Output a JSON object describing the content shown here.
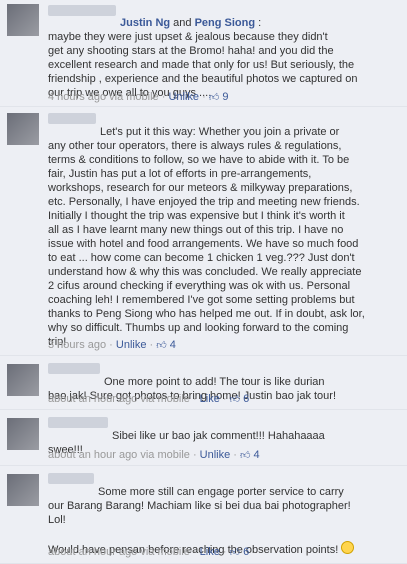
{
  "comments": [
    {
      "mention_prefix": "",
      "mention_1": "Justin Ng",
      "mention_and": " and ",
      "mention_2": "Peng Siong",
      "mention_suffix": " :",
      "text": "maybe they were just upset & jealous because they didn't\nget any shooting stars at the Bromo! haha! and you did the\nexcellent research and made that only for us! But seriously, the\nfriendship , experience and the beautiful photos we captured on\nour trip we owe all to you guys ....",
      "time": "4 hours ago via mobile",
      "action": "Unlike",
      "likes": "9"
    },
    {
      "text": "Let's put it this way: Whether you join a private or\nany other tour operators, there is always rules & regulations,\nterms & conditions to follow, so we have to abide with it. To be\nfair, Justin has put a lot of efforts in pre-arrangements,\nworkshops, research for our meteors & milkyway preparations,\netc. Personally, I have enjoyed the trip and meeting new friends.\nInitially I thought the trip was expensive but I think it's worth it\nall as I have learnt many new things out of this trip. I have no\nissue with hotel and food arrangements. We have so much food\nto eat ... how come can become 1 chicken 1 veg.??? Just don't\nunderstand how & why this was concluded. We really appreciate\n2 cifus around checking if everything was ok with us. Personal\ncoaching leh! I remembered I've got some setting problems but\nthanks to Peng Siong who has helped me out. If in doubt, ask lor,\nwhy so difficult. Thumbs up and looking forward to the coming\ntrip!",
      "time": "3 hours ago",
      "action": "Unlike",
      "likes": "4"
    },
    {
      "text": "One more point to add! The tour is like durian\nbao jak! Sure got photos to bring home! Justin bao jak tour!",
      "time": "about an hour ago via mobile",
      "action": "Like",
      "likes": "6"
    },
    {
      "text": "Sibei like ur bao jak comment!!! Hahahaaaa\nswee!!!",
      "time": "about an hour ago via mobile",
      "action": "Unlike",
      "likes": "4"
    },
    {
      "text": "Some more still can engage porter service to carry\nour Barang Barang! Machiam like si bei dua bai photographer!\nLol!\n\nWould have pensan before reaching the observation points!",
      "time": "about an hour ago via mobile",
      "action": "Like",
      "likes": "6"
    }
  ],
  "ui": {
    "separator": " · ",
    "thumb_icon": "thumbs-up-icon",
    "emoji_icon": "smiley-icon"
  }
}
